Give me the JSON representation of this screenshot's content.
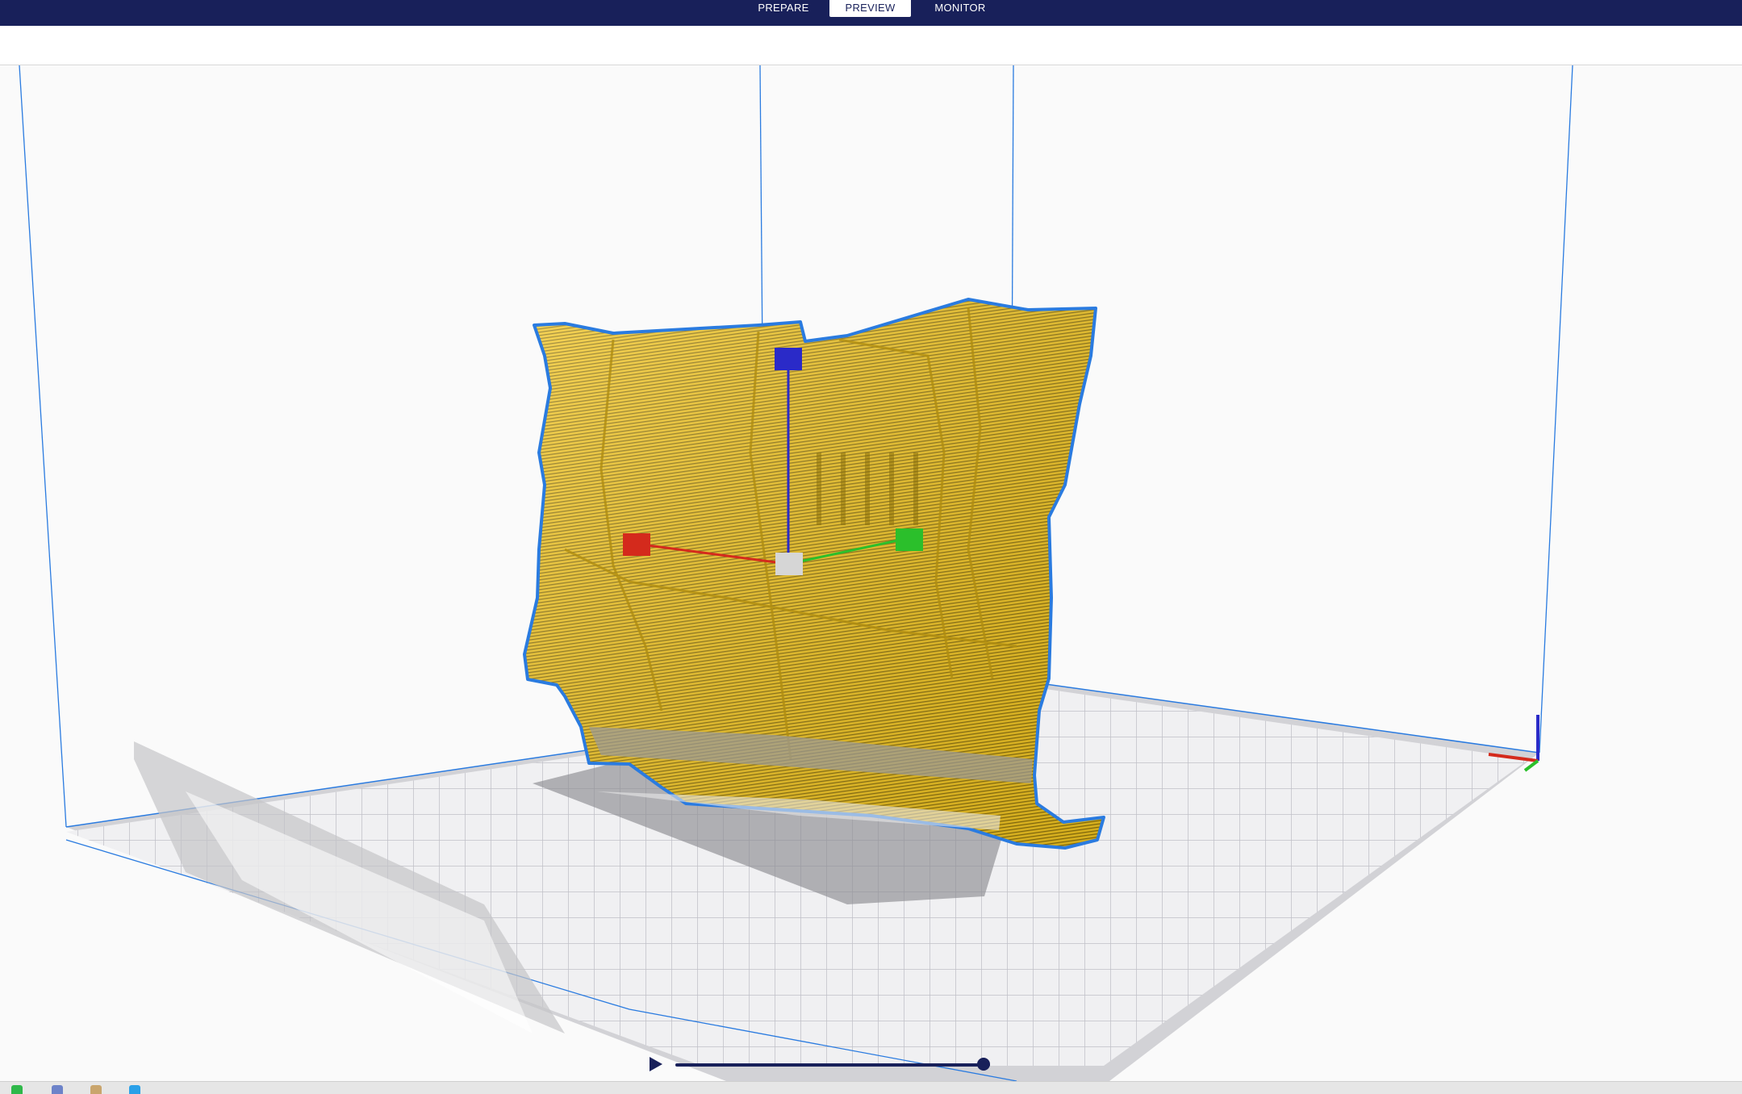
{
  "tabs": [
    {
      "label": "PREPARE",
      "active": false
    },
    {
      "label": "PREVIEW",
      "active": true
    },
    {
      "label": "MONITOR",
      "active": false
    }
  ],
  "colors": {
    "header": "#18205a",
    "model_fill": "#f2c520",
    "model_outline": "#2a7be0",
    "axis_x": "#d42a1c",
    "axis_y": "#2bbf2b",
    "axis_z": "#2a2ac8",
    "build_plate_grid": "#c0c0c8"
  },
  "icons": {
    "play": "play-icon",
    "slider_handle": "slider-handle-icon"
  },
  "preview": {
    "layer_progress": 0.98
  }
}
